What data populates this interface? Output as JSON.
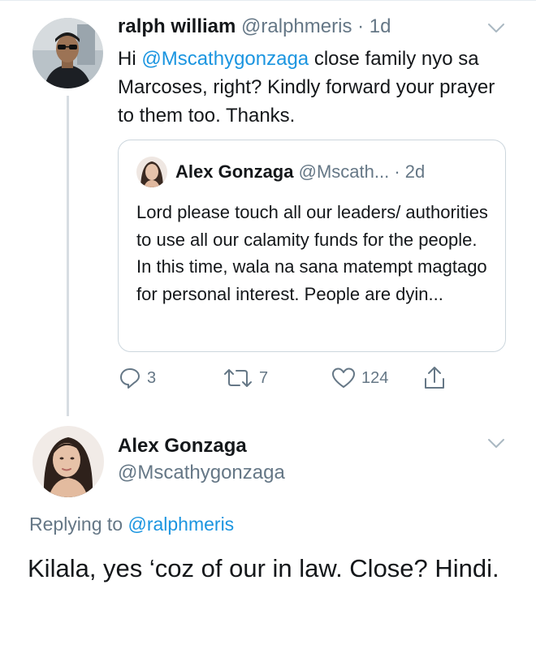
{
  "tweet": {
    "author_name": "ralph william",
    "author_handle": "@ralphmeris",
    "time": "· 1d",
    "text_prefix": "Hi ",
    "mention": "@Mscathygonzaga",
    "text_rest": " close family nyo sa Marcoses, right? Kindly forward your prayer to them too. Thanks.",
    "avatar_icon": "profile-photo-man-sunglasses"
  },
  "quoted_tweet": {
    "author_name": "Alex Gonzaga",
    "author_handle": "@Mscath...",
    "time": "· 2d",
    "text": "Lord please touch all our leaders/ authorities to use all our calamity funds for the people. In this time, wala na sana matempt magtago for personal interest. People are dyin...",
    "avatar_icon": "profile-photo-woman"
  },
  "actions": {
    "reply_count": "3",
    "retweet_count": "7",
    "like_count": "124",
    "reply_icon": "reply-icon",
    "retweet_icon": "retweet-icon",
    "like_icon": "heart-icon",
    "share_icon": "share-icon"
  },
  "reply": {
    "author_name": "Alex Gonzaga",
    "author_handle": "@Mscathygonzaga",
    "replying_prefix": "Replying to ",
    "replying_to": "@ralphmeris",
    "text": "Kilala, yes ‘coz of our in law. Close? Hindi.",
    "avatar_icon": "profile-photo-woman"
  },
  "colors": {
    "link": "#1b95e0",
    "muted": "#657786",
    "text": "#14171a",
    "border": "#ccd6dd"
  }
}
